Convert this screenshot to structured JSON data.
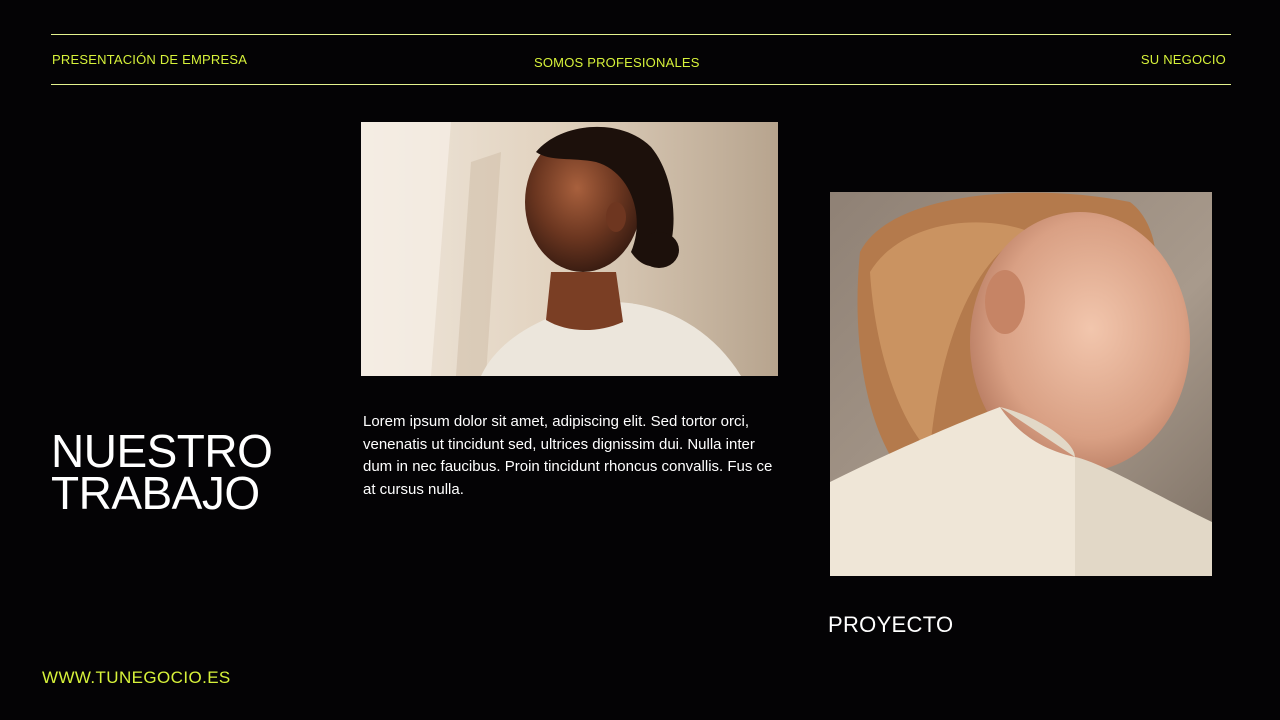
{
  "header": {
    "left": "PRESENTACIÓN DE EMPRESA",
    "center": "SOMOS PROFESIONALES",
    "right": "SU NEGOCIO"
  },
  "title": {
    "line1": "NUESTRO",
    "line2": "TRABAJO"
  },
  "body": "Lorem ipsum dolor sit amet, adipiscing elit. Sed tortor orci, venenatis ut tincidunt sed, ultrices dignissim dui. Nulla inter dum in nec faucibus. Proin tincidunt rhoncus convallis. Fus ce at cursus nulla.",
  "caption": "PROYECTO",
  "footer": {
    "url": "WWW.TUNEGOCIO.ES"
  },
  "colors": {
    "background": "#040305",
    "accent": "#d7f23a",
    "text": "#ffffff"
  }
}
